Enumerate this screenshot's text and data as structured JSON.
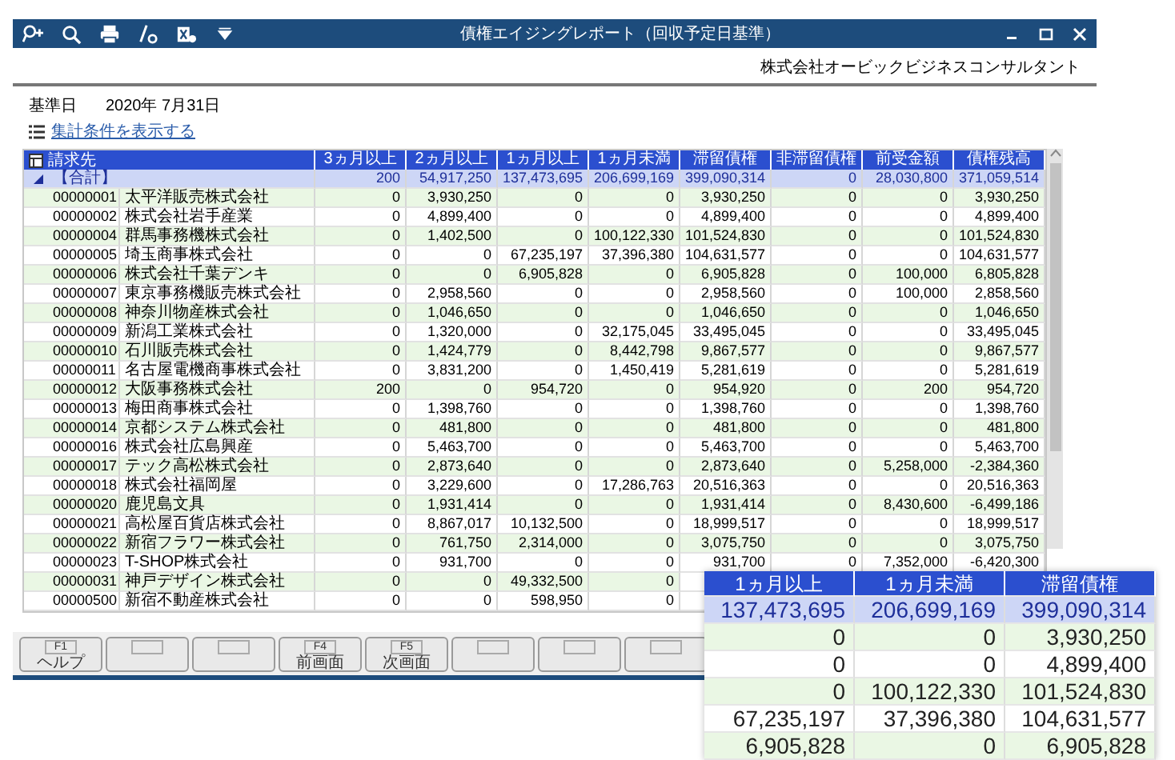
{
  "window": {
    "title": "債権エイジングレポート（回収予定日基準）"
  },
  "company": "株式会社オービックビジネスコンサルタント",
  "base_date": {
    "label": "基準日",
    "value": "2020年  7月31日"
  },
  "conditions_link": "集計条件を表示する",
  "table": {
    "columns": [
      "請求先",
      "3ヵ月以上",
      "2ヵ月以上",
      "1ヵ月以上",
      "1ヵ月未満",
      "滞留債権",
      "非滞留債権",
      "前受金額",
      "債権残高"
    ],
    "total": {
      "label": "【合計】",
      "expanded": true,
      "values": [
        "200",
        "54,917,250",
        "137,473,695",
        "206,699,169",
        "399,090,314",
        "0",
        "28,030,800",
        "371,059,514"
      ]
    },
    "rows": [
      {
        "code": "00000001",
        "name": "太平洋販売株式会社",
        "values": [
          "0",
          "3,930,250",
          "0",
          "0",
          "3,930,250",
          "0",
          "0",
          "3,930,250"
        ]
      },
      {
        "code": "00000002",
        "name": "株式会社岩手産業",
        "values": [
          "0",
          "4,899,400",
          "0",
          "0",
          "4,899,400",
          "0",
          "0",
          "4,899,400"
        ]
      },
      {
        "code": "00000004",
        "name": "群馬事務機株式会社",
        "values": [
          "0",
          "1,402,500",
          "0",
          "100,122,330",
          "101,524,830",
          "0",
          "0",
          "101,524,830"
        ]
      },
      {
        "code": "00000005",
        "name": "埼玉商事株式会社",
        "values": [
          "0",
          "0",
          "67,235,197",
          "37,396,380",
          "104,631,577",
          "0",
          "0",
          "104,631,577"
        ]
      },
      {
        "code": "00000006",
        "name": "株式会社千葉デンキ",
        "values": [
          "0",
          "0",
          "6,905,828",
          "0",
          "6,905,828",
          "0",
          "100,000",
          "6,805,828"
        ]
      },
      {
        "code": "00000007",
        "name": "東京事務機販売株式会社",
        "values": [
          "0",
          "2,958,560",
          "0",
          "0",
          "2,958,560",
          "0",
          "100,000",
          "2,858,560"
        ]
      },
      {
        "code": "00000008",
        "name": "神奈川物産株式会社",
        "values": [
          "0",
          "1,046,650",
          "0",
          "0",
          "1,046,650",
          "0",
          "0",
          "1,046,650"
        ]
      },
      {
        "code": "00000009",
        "name": "新潟工業株式会社",
        "values": [
          "0",
          "1,320,000",
          "0",
          "32,175,045",
          "33,495,045",
          "0",
          "0",
          "33,495,045"
        ]
      },
      {
        "code": "00000010",
        "name": "石川販売株式会社",
        "values": [
          "0",
          "1,424,779",
          "0",
          "8,442,798",
          "9,867,577",
          "0",
          "0",
          "9,867,577"
        ]
      },
      {
        "code": "00000011",
        "name": "名古屋電機商事株式会社",
        "values": [
          "0",
          "3,831,200",
          "0",
          "1,450,419",
          "5,281,619",
          "0",
          "0",
          "5,281,619"
        ]
      },
      {
        "code": "00000012",
        "name": "大阪事務株式会社",
        "values": [
          "200",
          "0",
          "954,720",
          "0",
          "954,920",
          "0",
          "200",
          "954,720"
        ]
      },
      {
        "code": "00000013",
        "name": "梅田商事株式会社",
        "values": [
          "0",
          "1,398,760",
          "0",
          "0",
          "1,398,760",
          "0",
          "0",
          "1,398,760"
        ]
      },
      {
        "code": "00000014",
        "name": "京都システム株式会社",
        "values": [
          "0",
          "481,800",
          "0",
          "0",
          "481,800",
          "0",
          "0",
          "481,800"
        ]
      },
      {
        "code": "00000016",
        "name": "株式会社広島興産",
        "values": [
          "0",
          "5,463,700",
          "0",
          "0",
          "5,463,700",
          "0",
          "0",
          "5,463,700"
        ]
      },
      {
        "code": "00000017",
        "name": "テック高松株式会社",
        "values": [
          "0",
          "2,873,640",
          "0",
          "0",
          "2,873,640",
          "0",
          "5,258,000",
          "-2,384,360"
        ]
      },
      {
        "code": "00000018",
        "name": "株式会社福岡屋",
        "values": [
          "0",
          "3,229,600",
          "0",
          "17,286,763",
          "20,516,363",
          "0",
          "0",
          "20,516,363"
        ]
      },
      {
        "code": "00000020",
        "name": "鹿児島文具",
        "values": [
          "0",
          "1,931,414",
          "0",
          "0",
          "1,931,414",
          "0",
          "8,430,600",
          "-6,499,186"
        ]
      },
      {
        "code": "00000021",
        "name": "高松屋百貨店株式会社",
        "values": [
          "0",
          "8,867,017",
          "10,132,500",
          "0",
          "18,999,517",
          "0",
          "0",
          "18,999,517"
        ]
      },
      {
        "code": "00000022",
        "name": "新宿フラワー株式会社",
        "values": [
          "0",
          "761,750",
          "2,314,000",
          "0",
          "3,075,750",
          "0",
          "0",
          "3,075,750"
        ]
      },
      {
        "code": "00000023",
        "name": "T-SHOP株式会社",
        "values": [
          "0",
          "931,700",
          "0",
          "0",
          "931,700",
          "0",
          "7,352,000",
          "-6,420,300"
        ]
      },
      {
        "code": "00000031",
        "name": "神戸デザイン株式会社",
        "values": [
          "0",
          "0",
          "49,332,500",
          "0"
        ]
      },
      {
        "code": "00000500",
        "name": "新宿不動産株式会社",
        "values": [
          "0",
          "0",
          "598,950",
          "0"
        ]
      }
    ]
  },
  "function_keys": [
    {
      "kind": "assigned",
      "key": "F1",
      "label": "ヘルプ"
    },
    {
      "kind": "blank"
    },
    {
      "kind": "blank"
    },
    {
      "kind": "assigned",
      "key": "F4",
      "label": "前画面"
    },
    {
      "kind": "assigned",
      "key": "F5",
      "label": "次画面"
    },
    {
      "kind": "blank"
    },
    {
      "kind": "blank"
    },
    {
      "kind": "blank"
    }
  ],
  "zoom_inset": {
    "columns": [
      "1ヵ月以上",
      "1ヵ月未満",
      "滞留債権"
    ],
    "total": [
      "137,473,695",
      "206,699,169",
      "399,090,314"
    ],
    "rows": [
      [
        "0",
        "0",
        "3,930,250"
      ],
      [
        "0",
        "0",
        "4,899,400"
      ],
      [
        "0",
        "100,122,330",
        "101,524,830"
      ],
      [
        "67,235,197",
        "37,396,380",
        "104,631,577"
      ],
      [
        "6,905,828",
        "0",
        "6,905,828"
      ]
    ]
  }
}
